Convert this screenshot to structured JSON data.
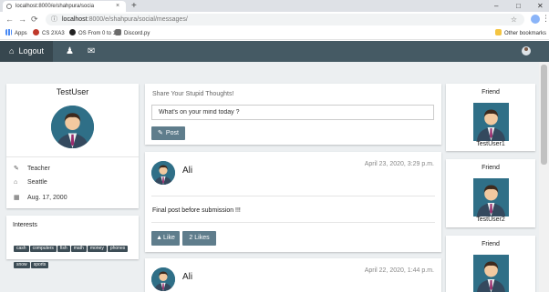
{
  "browser": {
    "tab_title": "localhost:8000/e/shahpura/socia",
    "tab_close": "×",
    "new_tab": "+",
    "win_min": "–",
    "win_max": "□",
    "win_close": "✕",
    "back": "←",
    "forward": "→",
    "reload": "⟳",
    "info_icon": "ⓘ",
    "url_host": "localhost",
    "url_path": ":8000/e/shahpura/social/messages/",
    "star": "☆",
    "menu": "⋮"
  },
  "bookmarks": {
    "apps": "Apps",
    "items": [
      "CS 2XA3",
      "OS From 0 to 1",
      "Discord.py"
    ],
    "other": "Other bookmarks"
  },
  "colors": {
    "navbar": "#455a64",
    "navbar_active": "#37474f",
    "page_bg": "#eceff1",
    "button": "#5f7d8c",
    "tag": "#3d4d56"
  },
  "navbar": {
    "logout_label": "Logout",
    "logout_icon": "home-icon",
    "person_icon": "person-icon",
    "mail_icon": "envelope-icon"
  },
  "profile": {
    "name": "TestUser",
    "job": "Teacher",
    "city": "Seattle",
    "birthday": "Aug. 17, 2000"
  },
  "interests": {
    "title": "Interests",
    "tags": [
      "cash",
      "computers",
      "fish",
      "math",
      "money",
      "phones",
      "snow",
      "sports"
    ]
  },
  "compose": {
    "title": "Share Your Stupid Thoughts!",
    "placeholder": "What's on your mind today ?",
    "post_label": "Post"
  },
  "posts": [
    {
      "author": "Ali",
      "date": "April 23, 2020, 3:29 p.m.",
      "text": "Final post before submission !!!",
      "like_label": "Like",
      "likes_label": "2  Likes"
    },
    {
      "author": "Ali",
      "date": "April 22, 2020, 1:44 p.m."
    }
  ],
  "friends": [
    {
      "label": "Friend",
      "name": "TestUser1"
    },
    {
      "label": "Friend",
      "name": "TestUser2"
    },
    {
      "label": "Friend",
      "name": ""
    }
  ]
}
